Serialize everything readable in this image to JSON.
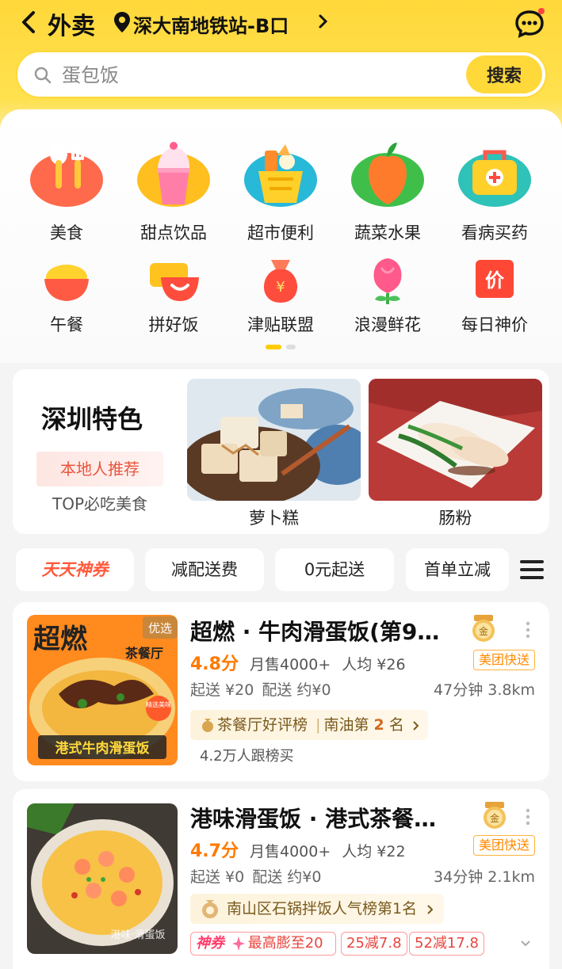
{
  "header": {
    "title": "外卖",
    "location": "深大南地铁站-B口"
  },
  "search": {
    "placeholder": "蛋包饭",
    "button_label": "搜索"
  },
  "categories_main": [
    {
      "label": "美食",
      "icon": "utensils-icon"
    },
    {
      "label": "甜点饮品",
      "icon": "dessert-cup-icon"
    },
    {
      "label": "超市便利",
      "icon": "shopping-basket-icon"
    },
    {
      "label": "蔬菜水果",
      "icon": "fruit-icon"
    },
    {
      "label": "看病买药",
      "icon": "medicine-box-icon"
    }
  ],
  "categories_sub": [
    {
      "label": "午餐",
      "icon": "rice-bowl-icon"
    },
    {
      "label": "拼好饭",
      "icon": "smile-bowl-icon"
    },
    {
      "label": "津贴联盟",
      "icon": "money-bag-icon"
    },
    {
      "label": "浪漫鲜花",
      "icon": "rose-icon"
    },
    {
      "label": "每日神价",
      "icon": "price-tag-icon"
    }
  ],
  "specials": {
    "title": "深圳特色",
    "tag1": "本地人推荐",
    "tag2": "TOP必吃美食",
    "items": [
      {
        "name": "萝卜糕"
      },
      {
        "name": "肠粉"
      }
    ]
  },
  "filters": [
    "天天神券",
    "减配送费",
    "0元起送",
    "首单立减"
  ],
  "shops": [
    {
      "name": "超燃 · 牛肉滑蛋饭(第9…",
      "rating": "4.8分",
      "monthly_sales": "月售4000+",
      "avg_price": "人均 ¥26",
      "min_order": "起送 ¥20",
      "delivery_fee": "配送 约¥0",
      "time": "47分钟",
      "distance": "3.8km",
      "delivery_badge": "美团快送",
      "rank_prefix": "茶餐厅好评榜",
      "rank_area": "南油第",
      "rank_num": "2",
      "rank_suffix": "名",
      "followers": "4.2万人跟榜买",
      "image_texts": {
        "top": "超燃",
        "tag": "优选",
        "sub": "茶餐厅",
        "seal": "精选美味",
        "bottom": "港式牛肉滑蛋饭"
      }
    },
    {
      "name": "港味滑蛋饭 · 港式茶餐…",
      "rating": "4.7分",
      "monthly_sales": "月售4000+",
      "avg_price": "人均 ¥22",
      "min_order": "起送 ¥0",
      "delivery_fee": "配送 约¥0",
      "time": "34分钟",
      "distance": "2.1km",
      "delivery_badge": "美团快送",
      "rank_text": "南山区石锅拌饭人气榜第1名",
      "promos": [
        "神券",
        "最高膨至20",
        "25减7.8",
        "52减17.8"
      ],
      "image_texts": {
        "watermark": "港味·滑蛋饭"
      }
    }
  ],
  "colors": {
    "brand_yellow": "#ffd83a",
    "accent_orange": "#ff7a00",
    "promo_red": "#e8453e"
  }
}
